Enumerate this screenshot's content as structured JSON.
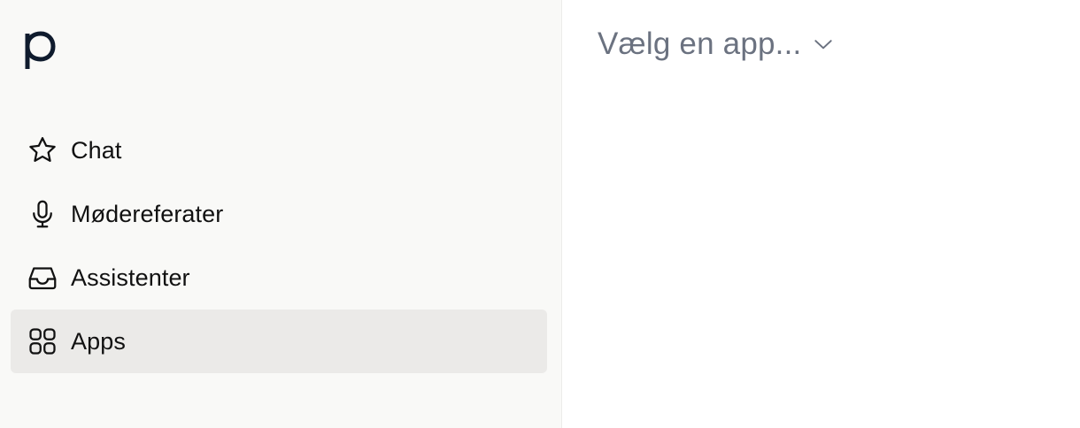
{
  "brand": {
    "logo_icon": "p-logo-icon",
    "logo_color": "#0f1b2d"
  },
  "sidebar": {
    "items": [
      {
        "label": "Chat",
        "icon": "star-icon",
        "active": false
      },
      {
        "label": "Mødereferater",
        "icon": "microphone-icon",
        "active": false
      },
      {
        "label": "Assistenter",
        "icon": "inbox-icon",
        "active": false
      },
      {
        "label": "Apps",
        "icon": "grid-icon",
        "active": true
      }
    ]
  },
  "main": {
    "app_select": {
      "placeholder": "Vælg en app...",
      "icon": "chevron-down-icon"
    }
  },
  "colors": {
    "sidebar_bg": "#f9f9f7",
    "active_item_bg": "#ebeae8",
    "placeholder_text": "#6b7280"
  }
}
